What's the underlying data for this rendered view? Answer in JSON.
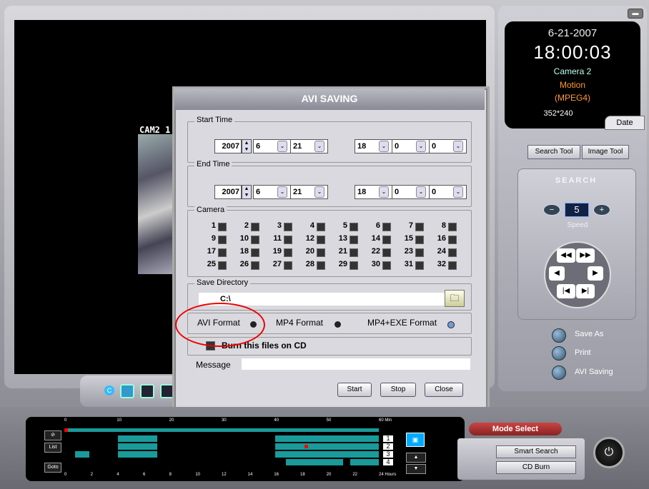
{
  "display": {
    "date": "6-21-2007",
    "time": "18:00:03",
    "camera": "Camera 2",
    "event": "Motion",
    "codec": "(MPEG4)",
    "resolution": "352*240",
    "date_tab": "Date"
  },
  "video": {
    "cam_label": "CAM2  1"
  },
  "tools": {
    "search_tool": "Search Tool",
    "image_tool": "Image Tool"
  },
  "search": {
    "title": "SEARCH",
    "speed_value": "5",
    "speed_label": "Speed"
  },
  "side_options": [
    {
      "label": "Save As"
    },
    {
      "label": "Print"
    },
    {
      "label": "AVI Saving"
    }
  ],
  "dialog": {
    "title": "AVI SAVING",
    "start_time": {
      "label": "Start Time",
      "year": "2007",
      "month": "6",
      "day": "21",
      "hour": "18",
      "minute": "0",
      "second": "0"
    },
    "end_time": {
      "label": "End Time",
      "year": "2007",
      "month": "6",
      "day": "21",
      "hour": "18",
      "minute": "0",
      "second": "0"
    },
    "camera": {
      "label": "Camera",
      "numbers": [
        "1",
        "2",
        "3",
        "4",
        "5",
        "6",
        "7",
        "8",
        "9",
        "10",
        "11",
        "12",
        "13",
        "14",
        "15",
        "16",
        "17",
        "18",
        "19",
        "20",
        "21",
        "22",
        "23",
        "24",
        "25",
        "26",
        "27",
        "28",
        "29",
        "30",
        "31",
        "32"
      ]
    },
    "save_directory": {
      "label": "Save Directory",
      "value": "C:\\"
    },
    "formats": [
      {
        "label": "AVI Format",
        "selected": false
      },
      {
        "label": "MP4 Format",
        "selected": false
      },
      {
        "label": "MP4+EXE Format",
        "selected": true
      }
    ],
    "burn_cd": "Burn this files on CD",
    "message_label": "Message",
    "buttons": {
      "start": "Start",
      "stop": "Stop",
      "close": "Close"
    }
  },
  "timeline": {
    "minute_ticks": [
      "0",
      "10",
      "20",
      "30",
      "40",
      "50",
      "60 Min"
    ],
    "hour_ticks": [
      "0",
      "2",
      "4",
      "6",
      "8",
      "10",
      "12",
      "14",
      "16",
      "18",
      "20",
      "22",
      "24 Hours"
    ],
    "channels": [
      "1",
      "2",
      "3",
      "4"
    ],
    "list_label": "List",
    "goto_label": "Goto"
  },
  "mode": {
    "title": "Mode Select",
    "smart_search": "Smart Search",
    "cd_burn": "CD Burn"
  },
  "colors": {
    "timeline_bar": "#1a9a9a",
    "accent_orange": "#ff9933",
    "highlight": "#ee0000"
  }
}
